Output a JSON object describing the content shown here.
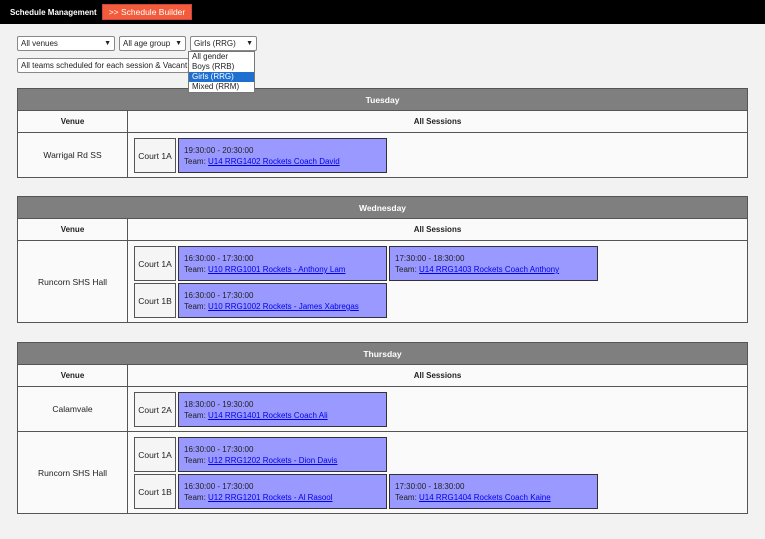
{
  "topbar": {
    "brand": "Schedule Management",
    "builder_button": ">> Schedule Builder"
  },
  "filters": {
    "venue": "All venues",
    "age": "All age group",
    "gender": "Girls (RRG)",
    "gender_options": [
      "All gender",
      "Boys (RRB)",
      "Girls (RRG)",
      "Mixed (RRM)"
    ],
    "display": "All teams scheduled for each session & Vacant"
  },
  "headers": {
    "venue": "Venue",
    "sessions": "All Sessions"
  },
  "team_prefix": "Team:",
  "days": [
    {
      "name": "Tuesday",
      "venues": [
        {
          "name": "Warrigal Rd SS",
          "courts": [
            {
              "name": "Court 1A",
              "sessions": [
                {
                  "time": "19:30:00 - 20:30:00",
                  "team": "U14 RRG1402 Rockets Coach David"
                }
              ]
            }
          ]
        }
      ]
    },
    {
      "name": "Wednesday",
      "venues": [
        {
          "name": "Runcorn SHS Hall",
          "courts": [
            {
              "name": "Court 1A",
              "sessions": [
                {
                  "time": "16:30:00 - 17:30:00",
                  "team": "U10 RRG1001 Rockets - Anthony Lam"
                },
                {
                  "time": "17:30:00 - 18:30:00",
                  "team": "U14 RRG1403 Rockets Coach Anthony"
                }
              ]
            },
            {
              "name": "Court 1B",
              "sessions": [
                {
                  "time": "16:30:00 - 17:30:00",
                  "team": "U10 RRG1002 Rockets - James Xabregas"
                }
              ]
            }
          ]
        }
      ]
    },
    {
      "name": "Thursday",
      "venues": [
        {
          "name": "Calamvale",
          "courts": [
            {
              "name": "Court 2A",
              "sessions": [
                {
                  "time": "18:30:00 - 19:30:00",
                  "team": "U14 RRG1401 Rockets Coach Ali"
                }
              ]
            }
          ]
        },
        {
          "name": "Runcorn SHS Hall",
          "courts": [
            {
              "name": "Court 1A",
              "sessions": [
                {
                  "time": "16:30:00 - 17:30:00",
                  "team": "U12 RRG1202 Rockets - Dion Davis"
                }
              ]
            },
            {
              "name": "Court 1B",
              "sessions": [
                {
                  "time": "16:30:00 - 17:30:00",
                  "team": "U12 RRG1201 Rockets - Al Rasool"
                },
                {
                  "time": "17:30:00 - 18:30:00",
                  "team": "U14 RRG1404 Rockets Coach Kaine"
                }
              ]
            }
          ]
        }
      ]
    }
  ]
}
